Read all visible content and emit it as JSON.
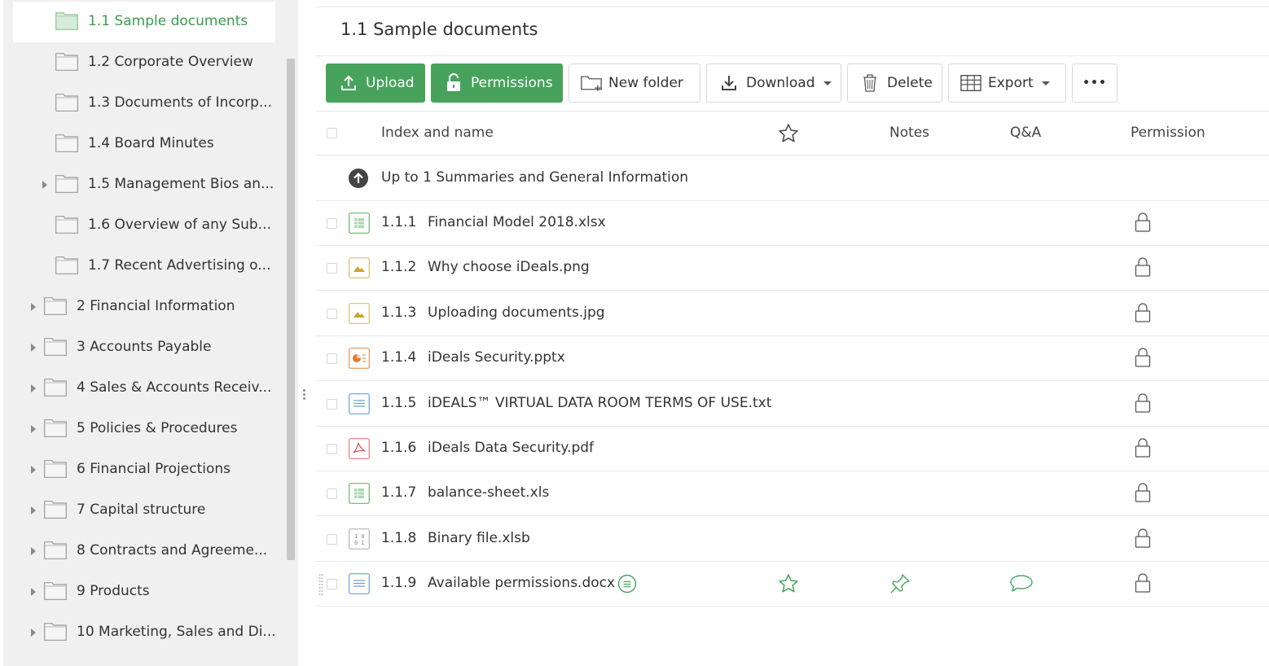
{
  "sidebar": {
    "items": [
      {
        "label": "1.1 Sample documents",
        "level": 2,
        "expandable": false,
        "active": true
      },
      {
        "label": "1.2 Corporate Overview",
        "level": 2,
        "expandable": false
      },
      {
        "label": "1.3 Documents of Incorp...",
        "level": 2,
        "expandable": false
      },
      {
        "label": "1.4 Board Minutes",
        "level": 2,
        "expandable": false
      },
      {
        "label": "1.5 Management Bios an...",
        "level": 2,
        "expandable": true
      },
      {
        "label": "1.6 Overview of any Sub...",
        "level": 2,
        "expandable": false
      },
      {
        "label": "1.7 Recent Advertising o...",
        "level": 2,
        "expandable": false
      },
      {
        "label": "2 Financial Information",
        "level": 1,
        "expandable": true
      },
      {
        "label": "3 Accounts Payable",
        "level": 1,
        "expandable": true
      },
      {
        "label": "4 Sales & Accounts Receiv...",
        "level": 1,
        "expandable": true
      },
      {
        "label": "5 Policies & Procedures",
        "level": 1,
        "expandable": true
      },
      {
        "label": "6 Financial Projections",
        "level": 1,
        "expandable": true
      },
      {
        "label": "7 Capital structure",
        "level": 1,
        "expandable": true
      },
      {
        "label": "8 Contracts and Agreeme...",
        "level": 1,
        "expandable": true
      },
      {
        "label": "9 Products",
        "level": 1,
        "expandable": true
      },
      {
        "label": "10 Marketing, Sales and Di...",
        "level": 1,
        "expandable": true
      }
    ]
  },
  "main": {
    "title": "1.1 Sample documents",
    "toolbar": {
      "upload": "Upload",
      "permissions": "Permissions",
      "new_folder": "New folder",
      "download": "Download",
      "delete": "Delete",
      "export": "Export",
      "more": "•••"
    },
    "columns": {
      "name": "Index and name",
      "notes": "Notes",
      "qa": "Q&A",
      "permission": "Permission"
    },
    "up_link": "Up to 1 Summaries and General Information",
    "files": [
      {
        "index": "1.1.1",
        "name": "Financial Model 2018.xlsx",
        "type": "spreadsheet-icon"
      },
      {
        "index": "1.1.2",
        "name": "Why choose iDeals.png",
        "type": "image-icon"
      },
      {
        "index": "1.1.3",
        "name": "Uploading documents.jpg",
        "type": "image-icon"
      },
      {
        "index": "1.1.4",
        "name": "iDeals Security.pptx",
        "type": "presentation-icon"
      },
      {
        "index": "1.1.5",
        "name": "iDEALS™ VIRTUAL DATA ROOM TERMS OF USE.txt",
        "type": "text-icon"
      },
      {
        "index": "1.1.6",
        "name": "iDeals Data Security.pdf",
        "type": "pdf-icon"
      },
      {
        "index": "1.1.7",
        "name": "balance-sheet.xls",
        "type": "spreadsheet-icon"
      },
      {
        "index": "1.1.8",
        "name": "Binary file.xlsb",
        "type": "binary-icon"
      },
      {
        "index": "1.1.9",
        "name": "Available permissions.docx",
        "type": "text-icon",
        "has_note_badge": true,
        "favorite": true,
        "pinned": true,
        "has_qa": true
      }
    ]
  },
  "colors": {
    "accent_green": "#47a35c",
    "active_label_green": "#3a9c4e",
    "sidebar_bg": "#f0f0f0"
  }
}
